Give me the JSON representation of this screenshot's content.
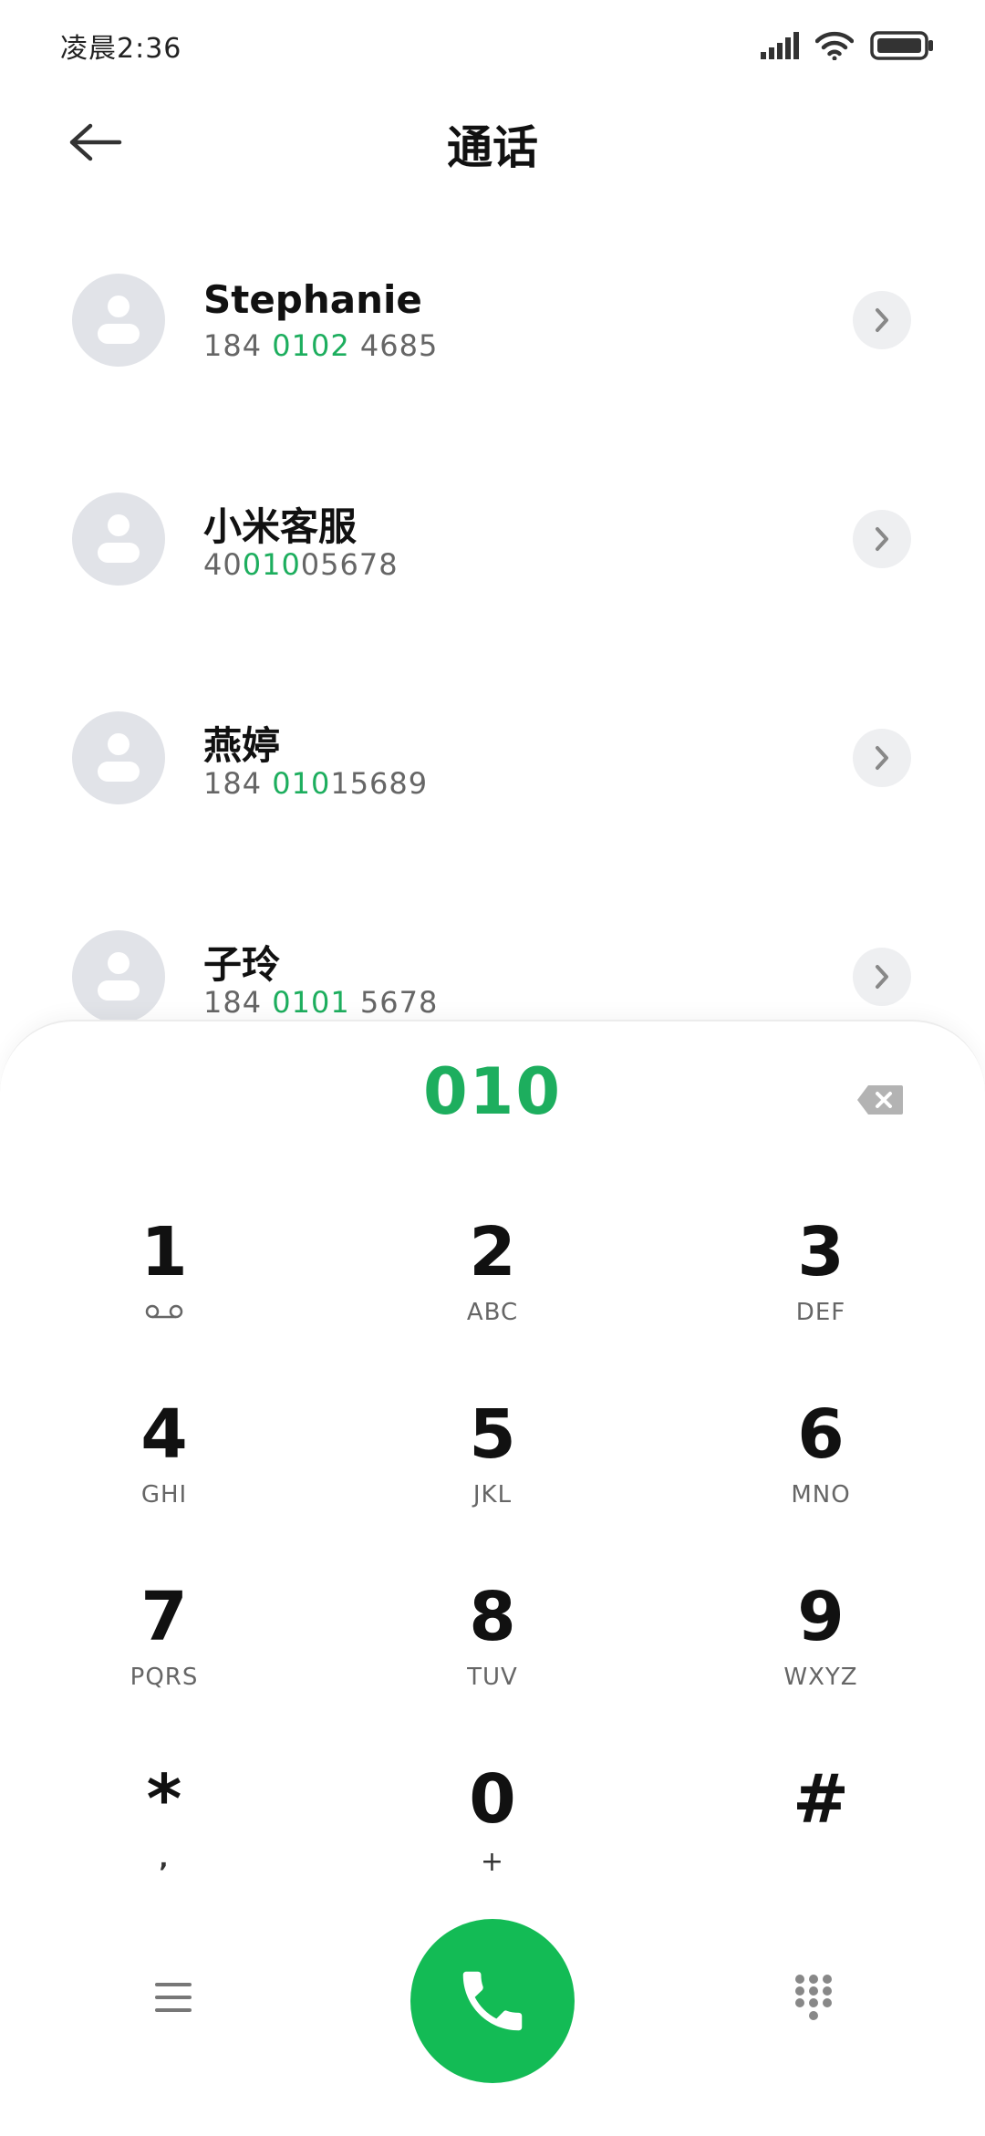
{
  "status_bar": {
    "time": "凌晨2:36"
  },
  "header": {
    "title": "通话"
  },
  "contacts": [
    {
      "name": "Stephanie",
      "number_pre": "184 ",
      "number_match": "0102",
      "number_post": " 4685"
    },
    {
      "name": "小米客服",
      "number_pre": "40",
      "number_match": "010",
      "number_post": "05678"
    },
    {
      "name": "燕婷",
      "number_pre": "184 ",
      "number_match": "010",
      "number_post": "15689"
    },
    {
      "name": "子玲",
      "number_pre": "184 ",
      "number_match": "0101",
      "number_post": " 5678"
    }
  ],
  "dialer": {
    "input": "010",
    "keys": [
      {
        "digit": "1",
        "letters": "",
        "icon": "voicemail-icon"
      },
      {
        "digit": "2",
        "letters": "ABC"
      },
      {
        "digit": "3",
        "letters": "DEF"
      },
      {
        "digit": "4",
        "letters": "GHI"
      },
      {
        "digit": "5",
        "letters": "JKL"
      },
      {
        "digit": "6",
        "letters": "MNO"
      },
      {
        "digit": "7",
        "letters": "PQRS"
      },
      {
        "digit": "8",
        "letters": "TUV"
      },
      {
        "digit": "9",
        "letters": "WXYZ"
      },
      {
        "digit": "*",
        "letters": ","
      },
      {
        "digit": "0",
        "letters": "+"
      },
      {
        "digit": "#",
        "letters": ""
      }
    ]
  },
  "colors": {
    "accent": "#1dae5e",
    "call_button": "#13bb55"
  }
}
